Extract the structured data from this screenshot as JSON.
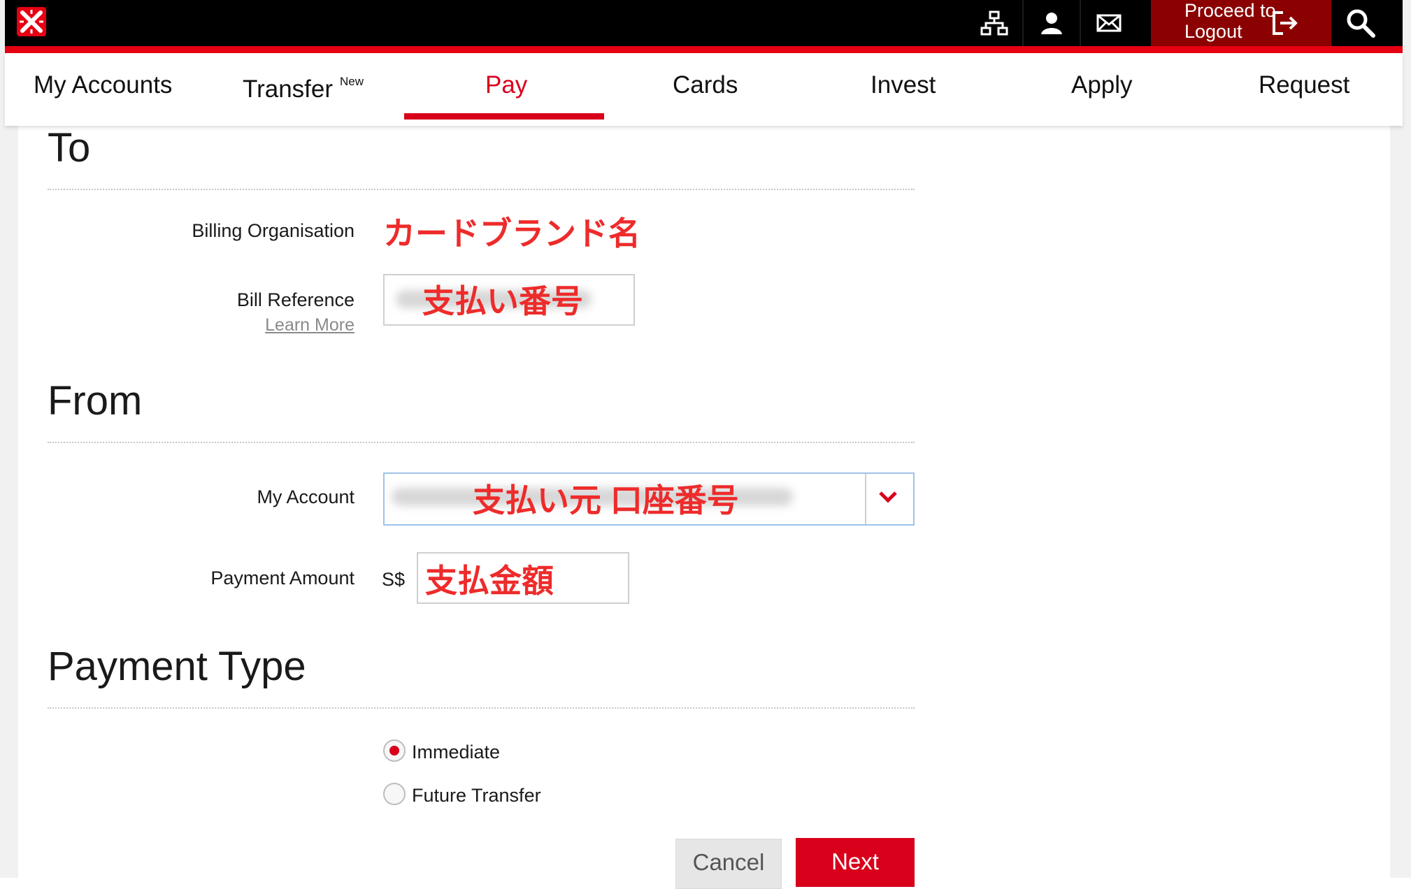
{
  "topbar": {
    "icons": [
      "sitemap-icon",
      "user-icon",
      "mail-icon",
      "logout-icon",
      "search-icon"
    ],
    "logout_line1": "Proceed to",
    "logout_line2": "Logout"
  },
  "nav": {
    "items": [
      {
        "label": "My Accounts"
      },
      {
        "label": "Transfer",
        "badge": "New"
      },
      {
        "label": "Pay",
        "active": true
      },
      {
        "label": "Cards"
      },
      {
        "label": "Invest"
      },
      {
        "label": "Apply"
      },
      {
        "label": "Request"
      }
    ]
  },
  "to_section": {
    "title": "To",
    "billing_label": "Billing Organisation",
    "billing_value": "カードブランド名",
    "bill_ref_label": "Bill Reference",
    "learn_more": "Learn More",
    "bill_ref_value": "支払い番号"
  },
  "from_section": {
    "title": "From",
    "account_label": "My Account",
    "account_value": "支払い元 口座番号",
    "amount_label": "Payment Amount",
    "currency": "S$",
    "amount_value": "支払金額"
  },
  "payment_type": {
    "title": "Payment Type",
    "options": [
      {
        "label": "Immediate",
        "selected": true
      },
      {
        "label": "Future Transfer",
        "selected": false
      }
    ]
  },
  "buttons": {
    "cancel": "Cancel",
    "next": "Next"
  },
  "colors": {
    "brand_red": "#d9001b",
    "annotation_red": "#ee2b2b",
    "topbar": "#000000",
    "logout_bg": "#8b0000"
  }
}
